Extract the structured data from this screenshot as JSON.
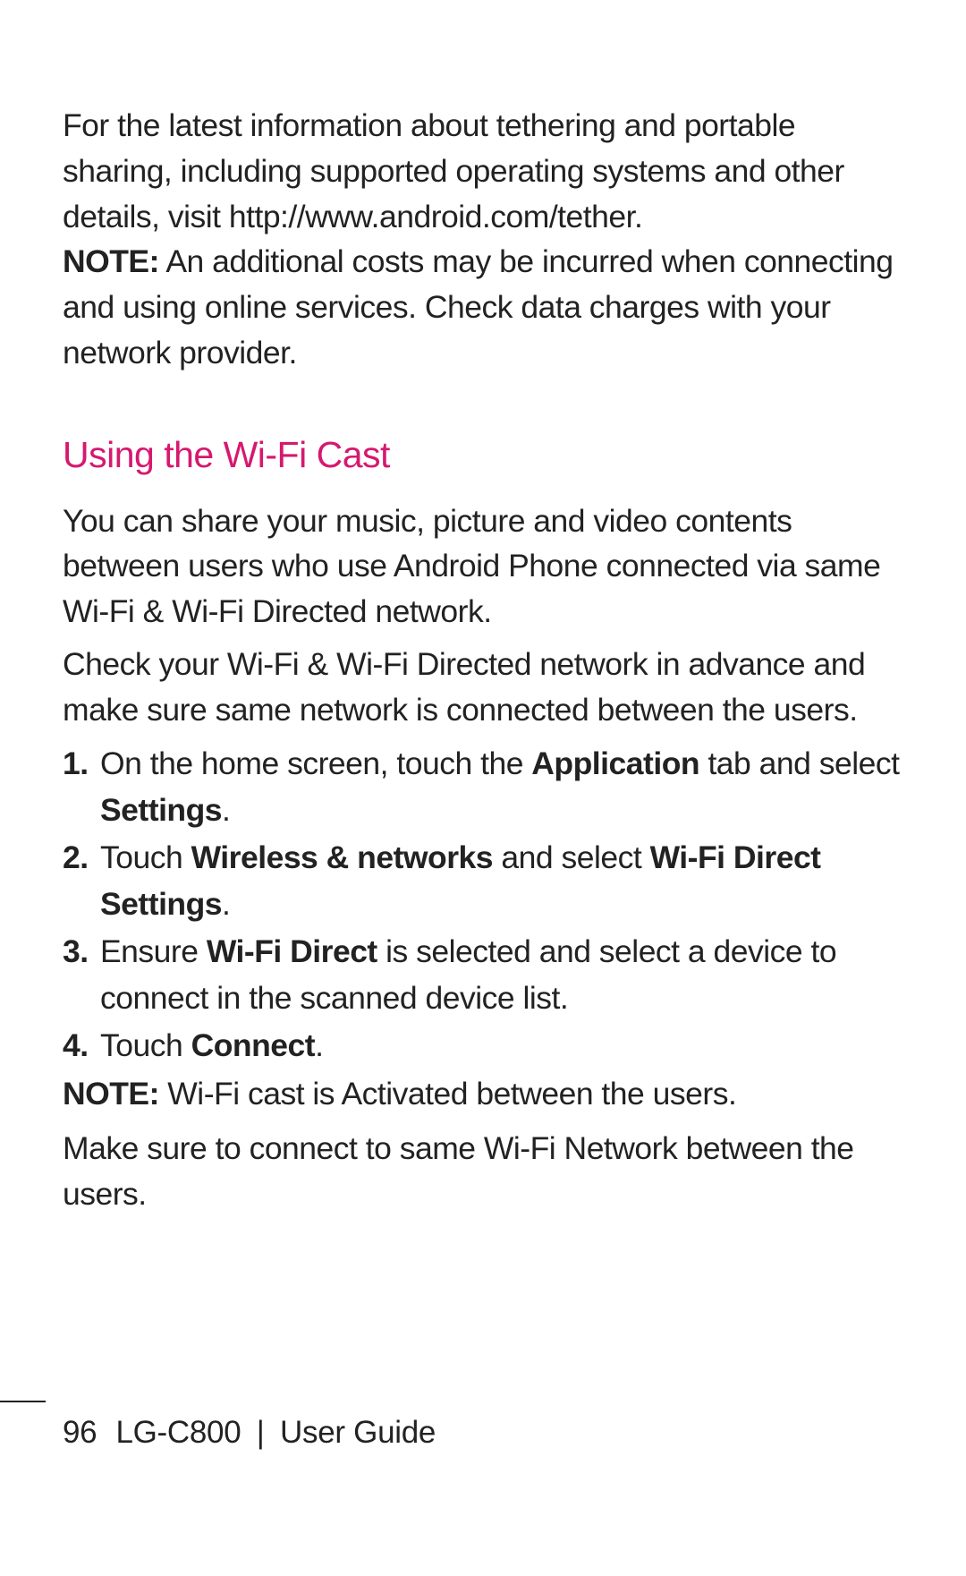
{
  "intro": {
    "para1": "For the latest information about tethering and portable sharing, including supported operating systems and other details, visit http://www.android.com/tether.",
    "note_label": "NOTE:",
    "note_text": " An additional costs may be incurred when connecting and using online services. Check data charges with your network provider."
  },
  "section": {
    "heading": "Using the Wi-Fi Cast",
    "para1": "You can share your music, picture and video contents between users who use Android Phone connected via same Wi-Fi & Wi-Fi Directed network.",
    "para2": "Check your Wi-Fi & Wi-Fi Directed network in advance and make sure same network is connected between the users.",
    "steps": [
      {
        "num": "1.",
        "pre": " On the home screen, touch the ",
        "b1": "Application",
        "mid": " tab and select ",
        "b2": "Settings",
        "post": "."
      },
      {
        "num": "2.",
        "pre": "Touch ",
        "b1": "Wireless & networks",
        "mid": " and select ",
        "b2": "Wi-Fi Direct Settings",
        "post": "."
      },
      {
        "num": "3.",
        "pre": "Ensure ",
        "b1": "Wi-Fi Direct",
        "mid": " is selected and select a device to connect in the scanned device list.",
        "b2": "",
        "post": ""
      },
      {
        "num": "4.",
        "pre": "Touch ",
        "b1": "Connect",
        "mid": ".",
        "b2": "",
        "post": ""
      }
    ],
    "note_label": "NOTE:",
    "note_text": " Wi-Fi cast is Activated between the users.",
    "final": "Make sure to connect to same Wi-Fi Network between the users."
  },
  "footer": {
    "page_number": "96",
    "model": "LG-C800",
    "divider": "|",
    "doc_title": "User Guide"
  }
}
